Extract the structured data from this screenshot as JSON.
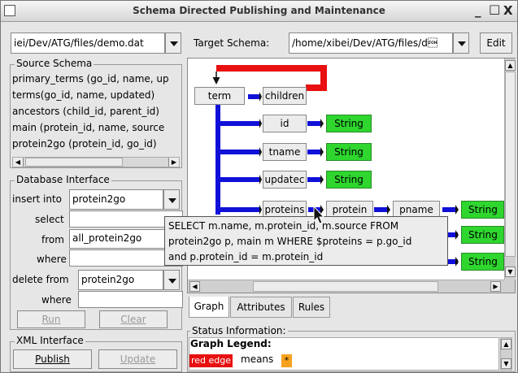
{
  "window": {
    "title": "Schema Directed Publishing and Maintenance",
    "minimize": "_",
    "maximize": "□",
    "close": "X"
  },
  "toolbar": {
    "source_file": "iei/Dev/ATG/files/demo.dat",
    "target_label": "Target Schema:",
    "target_file": "/home/xibei/Dev/ATG/files/d\u0001",
    "edit_label": "Edit"
  },
  "source_schema": {
    "title": "Source Schema",
    "items": [
      "primary_terms (go_id, name, up",
      "terms(go_id, name, updated)",
      "ancestors (child_id, parent_id)",
      "main (protein_id, name, source",
      "protein2go (protein_id, go_id)"
    ]
  },
  "database_interface": {
    "title": "Database Interface",
    "insert_label": "insert into",
    "insert_value": "protein2go",
    "select_label": "select",
    "select_value": "",
    "from_label": "from",
    "from_value": "all_protein2go",
    "where_label": "where",
    "where_value": "",
    "delete_label": "delete from",
    "delete_value": "protein2go",
    "where2_label": "where",
    "where2_value": "",
    "run_label": "Run",
    "clear_label": "Clear"
  },
  "xml_interface": {
    "title": "XML Interface",
    "publish_label": "Publish",
    "update_label": "Update"
  },
  "graph": {
    "nodes": {
      "term": "term",
      "children": "children",
      "id": "id",
      "tname": "tname",
      "updated": "updatec",
      "proteins": "proteins",
      "protein": "protein",
      "pname": "pname"
    },
    "string_label": "String",
    "tooltip": [
      "SELECT m.name, m.protein_id, m.source FROM",
      "protein2go p, main m  WHERE $proteins = p.go_id",
      "and p.protein_id = m.protein_id"
    ]
  },
  "tabs": [
    {
      "label": "Graph"
    },
    {
      "label": "Attributes"
    },
    {
      "label": "Rules"
    }
  ],
  "status": {
    "title": "Status Information:",
    "legend_label": "Graph Legend:",
    "red_edge": "red edge",
    "means": "means",
    "star": "*"
  },
  "colors": {
    "red": "#e81010",
    "blue": "#1010d8",
    "green": "#2ed62e",
    "orange": "#f7a21e"
  }
}
